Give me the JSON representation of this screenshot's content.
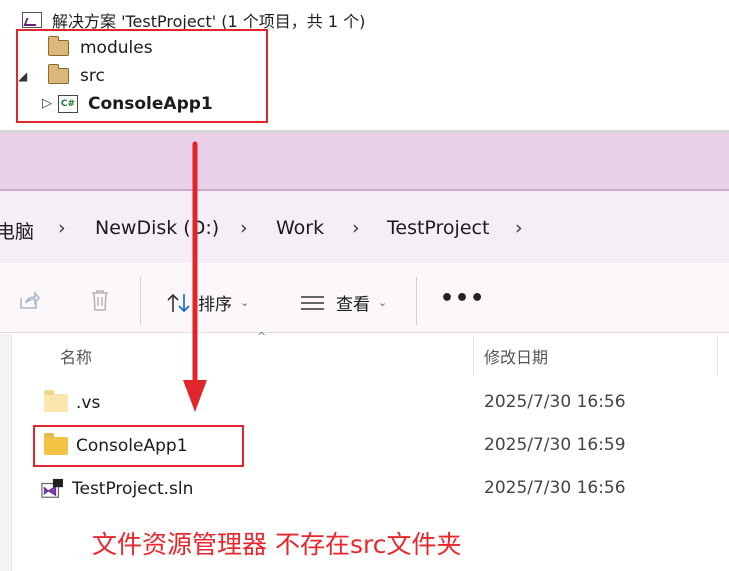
{
  "solution_explorer": {
    "solution_label": "解决方案 'TestProject' (1 个项目，共 1 个)",
    "items": [
      {
        "label": "modules"
      },
      {
        "label": "src"
      },
      {
        "label": "ConsoleApp1",
        "badge": "C#"
      }
    ]
  },
  "breadcrumbs": [
    {
      "label": "电脑"
    },
    {
      "label": "NewDisk (D:)"
    },
    {
      "label": "Work"
    },
    {
      "label": "TestProject"
    }
  ],
  "toolbar": {
    "sort_label": "排序",
    "view_label": "查看",
    "more_label": "•••"
  },
  "columns": {
    "name": "名称",
    "modified": "修改日期"
  },
  "files": [
    {
      "name": ".vs",
      "modified": "2025/7/30 16:56",
      "type": "folder"
    },
    {
      "name": "ConsoleApp1",
      "modified": "2025/7/30 16:59",
      "type": "folder"
    },
    {
      "name": "TestProject.sln",
      "modified": "2025/7/30 16:56",
      "type": "sln"
    }
  ],
  "annotation": "文件资源管理器 不存在src文件夹",
  "colors": {
    "annotation_red": "#e8262b",
    "title_lavender": "#ead1ea",
    "folder_yellow": "#f8d775"
  }
}
